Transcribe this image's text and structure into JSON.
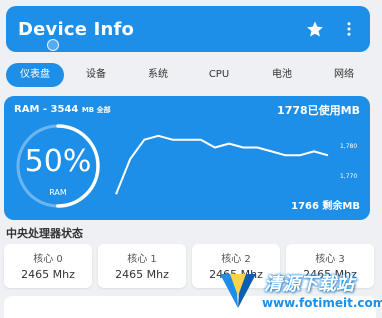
{
  "app": {
    "title": "Device Info",
    "star_icon": "star-icon",
    "menu_icon": "more-vert-icon"
  },
  "tabs": [
    {
      "label": "仪表盘",
      "active": true
    },
    {
      "label": "设备",
      "active": false
    },
    {
      "label": "系统",
      "active": false
    },
    {
      "label": "CPU",
      "active": false
    },
    {
      "label": "电池",
      "active": false
    },
    {
      "label": "网络",
      "active": false
    }
  ],
  "ram": {
    "title": "RAM - ",
    "total_value": "3544",
    "total_unit": "MB 全部",
    "used": "1778已使用MB",
    "free": "1766 剩余MB",
    "percent": "50%",
    "percent_value": 50,
    "gauge_label": "RAM",
    "axis_ticks": [
      "1,780",
      "1,770"
    ]
  },
  "chart_data": {
    "type": "line",
    "series": [
      {
        "values": [
          1768,
          1777,
          1782,
          1783,
          1782,
          1782,
          1782,
          1780,
          1781,
          1780,
          1780,
          1779,
          1778,
          1778,
          1779,
          1778
        ]
      }
    ],
    "ylim": [
      1766,
      1785
    ],
    "yticks": [
      "1,780",
      "1,770"
    ]
  },
  "cpu": {
    "section_title": "中央处理器状态",
    "cores": [
      {
        "name": "核心 0",
        "freq": "2465 Mhz"
      },
      {
        "name": "核心 1",
        "freq": "2465 Mhz"
      },
      {
        "name": "核心 2",
        "freq": "2465 Mhz"
      },
      {
        "name": "核心 3",
        "freq": "2465 Mhz"
      }
    ]
  },
  "watermark": {
    "name": "清源下载站",
    "url": "www.fotimeit.com"
  },
  "colors": {
    "accent": "#1e8fe8",
    "background": "#eef0f3"
  }
}
